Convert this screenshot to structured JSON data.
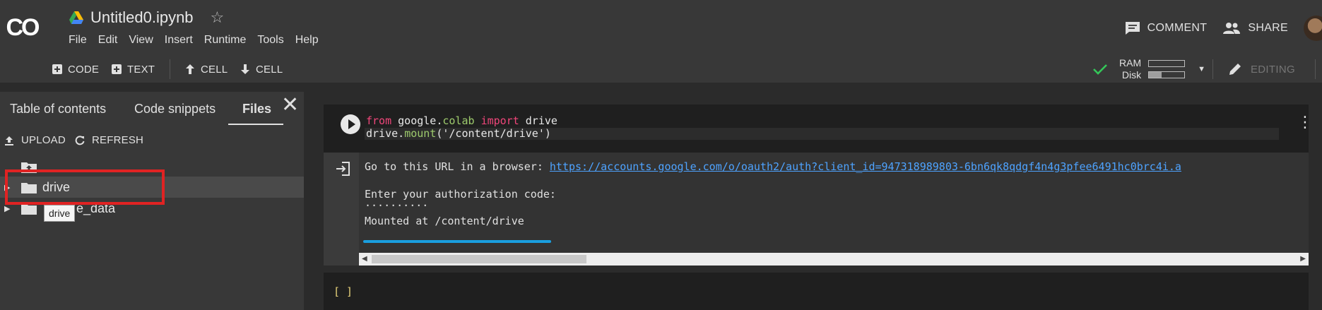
{
  "header": {
    "logo_text": "CO",
    "notebook_title": "Untitled0.ipynb",
    "menu": [
      "File",
      "Edit",
      "View",
      "Insert",
      "Runtime",
      "Tools",
      "Help"
    ],
    "comment_label": "COMMENT",
    "share_label": "SHARE"
  },
  "toolbar": {
    "add_code_label": "CODE",
    "add_text_label": "TEXT",
    "cell_up_label": "CELL",
    "cell_down_label": "CELL",
    "ram_label": "RAM",
    "disk_label": "Disk",
    "ram_fill": 0.0,
    "disk_fill": 0.35,
    "editing_label": "EDITING"
  },
  "sidebar": {
    "tabs": [
      {
        "label": "Table of contents",
        "active": false
      },
      {
        "label": "Code snippets",
        "active": false
      },
      {
        "label": "Files",
        "active": true
      }
    ],
    "upload_label": "UPLOAD",
    "refresh_label": "REFRESH",
    "tree": [
      {
        "label": "drive",
        "selected": true
      },
      {
        "label": "sample_data",
        "selected": false
      }
    ],
    "tooltip": "drive",
    "sample_data_suffix": "e_data"
  },
  "cells": {
    "cell1": {
      "code_line1": {
        "kw1": "from",
        "mod": "google",
        "dot": ".",
        "attr": "colab",
        "kw2": "import",
        "name": "drive"
      },
      "code_line2": {
        "obj": "drive",
        "dot": ".",
        "fn": "mount",
        "args": "('/content/drive')"
      },
      "output": {
        "line1_prefix": "Go to this URL in a browser: ",
        "line1_link": "https://accounts.google.com/o/oauth2/auth?client_id=947318989803-6bn6qk8qdgf4n4g3pfee6491hc0brc4i.a",
        "line2": "Enter your authorization code:",
        "line3": "··········",
        "line4": "Mounted at /content/drive"
      }
    },
    "cell2": {
      "prompt": "[ ]"
    }
  },
  "colors": {
    "accent_blue": "#1a9fe0",
    "highlight_red": "#e02323",
    "keyword_pink": "#f0467a",
    "attr_green": "#9ecb6d",
    "link_blue": "#4ea3ff",
    "check_green": "#34c759"
  }
}
